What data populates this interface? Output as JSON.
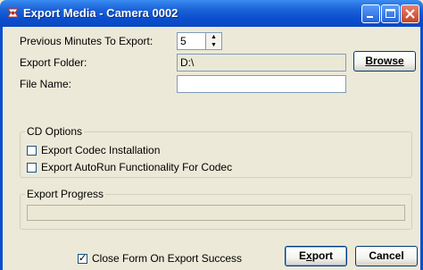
{
  "window": {
    "title": "Export Media - Camera 0002"
  },
  "form": {
    "previous_minutes_label": "Previous Minutes To Export:",
    "previous_minutes_value": "5",
    "export_folder_label": "Export Folder:",
    "export_folder_value": "D:\\",
    "browse_label": "Browse",
    "file_name_label": "File Name:",
    "file_name_value": ""
  },
  "cd_options": {
    "title": "CD Options",
    "items": [
      {
        "label": "Export Codec Installation",
        "checked": false
      },
      {
        "label": "Export AutoRun Functionality For Codec",
        "checked": false
      }
    ]
  },
  "export_progress": {
    "title": "Export Progress",
    "value": 0
  },
  "footer": {
    "close_on_success_label": "Close Form On Export Success",
    "close_on_success_checked": true,
    "export_label_pre": "E",
    "export_label_acc": "x",
    "export_label_post": "port",
    "cancel_label": "Cancel"
  },
  "icons": {
    "app": "camera-app-icon",
    "minimize": "minimize-icon",
    "maximize": "maximize-icon",
    "close": "close-icon"
  },
  "colors": {
    "titlebar": "#0b4ecf",
    "dialog_bg": "#ece9d8",
    "close_button": "#c4432a"
  }
}
